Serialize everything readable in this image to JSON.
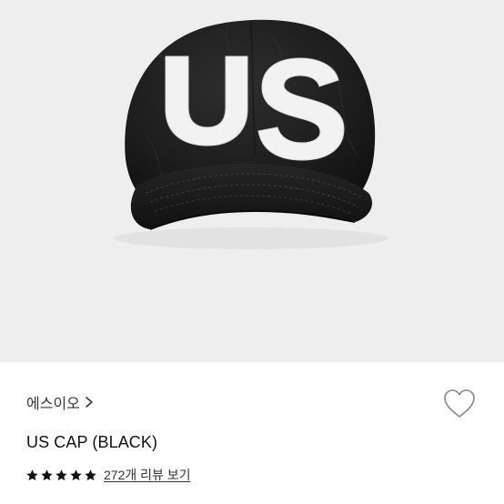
{
  "product": {
    "image_alt": "black baseball cap with white embroidered US letters",
    "brand_label": "에스이오",
    "title": "US CAP (BLACK)",
    "rating": 5,
    "rating_max": 5,
    "review_link": "272개 리뷰 보기"
  },
  "colors": {
    "image_background": "#eeeeee",
    "cap": "#1c1c1c",
    "embroidery": "#f2f2f2",
    "stars": "#111111",
    "heart_outline": "#888888"
  },
  "icons": {
    "brand_chevron": "chevron-right-icon",
    "wishlist": "heart-outline-icon",
    "star": "star-filled-icon"
  }
}
